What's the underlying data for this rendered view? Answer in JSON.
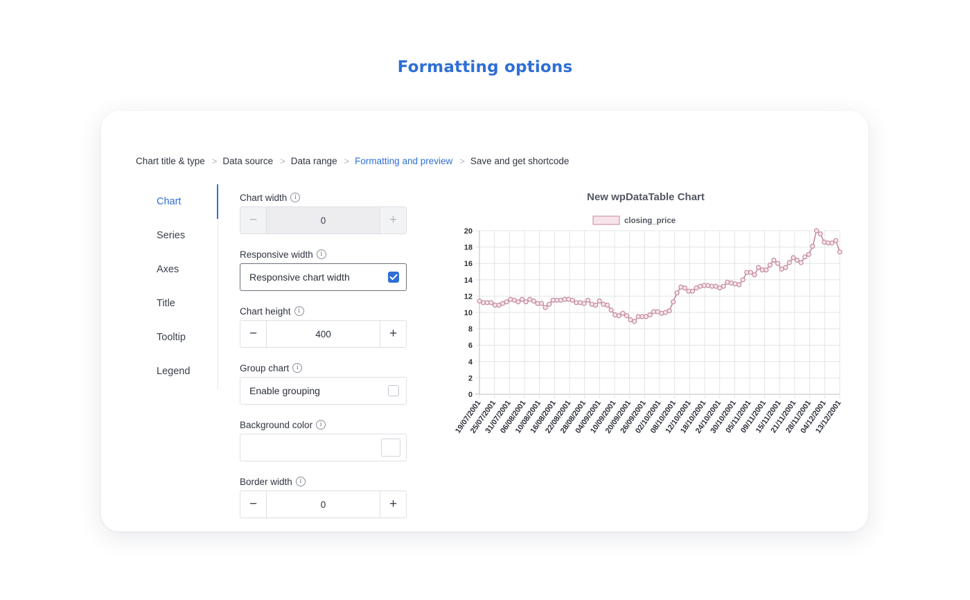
{
  "heading": "Formatting options",
  "breadcrumb": {
    "step1": "Chart title & type",
    "step2": "Data source",
    "step3": "Data range",
    "step4": "Formatting and preview",
    "step5": "Save and get shortcode",
    "separator": ">"
  },
  "sidebar": {
    "items": [
      "Chart",
      "Series",
      "Axes",
      "Title",
      "Tooltip",
      "Legend"
    ],
    "active": "Chart"
  },
  "form": {
    "chart_width": {
      "label": "Chart width",
      "value": "0",
      "disabled": true
    },
    "responsive_width": {
      "label": "Responsive width",
      "checkbox_label": "Responsive chart width",
      "checked": true
    },
    "chart_height": {
      "label": "Chart height",
      "value": "400"
    },
    "group_chart": {
      "label": "Group chart",
      "checkbox_label": "Enable grouping",
      "checked": false
    },
    "background_color": {
      "label": "Background color",
      "value": "#ffffff"
    },
    "border_width": {
      "label": "Border width",
      "value": "0"
    },
    "minus": "−",
    "plus": "+",
    "info": "i"
  },
  "colors": {
    "accent": "#2f6fd6",
    "series_line": "#c28a9b",
    "series_fill": "#f7e4ea"
  },
  "chart_data": {
    "type": "line",
    "title": "New wpDataTable Chart",
    "series": [
      {
        "name": "closing_price",
        "values": [
          11.4,
          11.2,
          11.2,
          11.2,
          10.9,
          10.9,
          11.1,
          11.3,
          11.6,
          11.5,
          11.3,
          11.6,
          11.3,
          11.6,
          11.4,
          11.1,
          11.1,
          10.6,
          11.0,
          11.5,
          11.5,
          11.5,
          11.6,
          11.6,
          11.5,
          11.2,
          11.2,
          11.1,
          11.5,
          11.0,
          10.9,
          11.4,
          11.0,
          10.9,
          10.3,
          9.7,
          9.6,
          9.9,
          9.6,
          9.1,
          8.9,
          9.5,
          9.5,
          9.5,
          9.7,
          10.1,
          10.1,
          9.9,
          10.0,
          10.2,
          11.3,
          12.4,
          13.1,
          13.0,
          12.6,
          12.6,
          13.0,
          13.2,
          13.3,
          13.3,
          13.2,
          13.2,
          13.0,
          13.2,
          13.7,
          13.6,
          13.5,
          13.4,
          14.0,
          14.9,
          14.9,
          14.6,
          15.5,
          15.2,
          15.2,
          15.8,
          16.4,
          16.0,
          15.3,
          15.5,
          16.1,
          16.7,
          16.4,
          16.1,
          16.8,
          17.1,
          18.1,
          20.0,
          19.6,
          18.6,
          18.5,
          18.5,
          18.8,
          17.4
        ]
      }
    ],
    "x_labels": [
      "19/07/2001",
      "25/07/2001",
      "31/07/2001",
      "06/08/2001",
      "10/08/2001",
      "16/08/2001",
      "22/08/2001",
      "28/08/2001",
      "04/09/2001",
      "10/09/2001",
      "20/09/2001",
      "26/09/2001",
      "02/10/2001",
      "08/10/2001",
      "12/10/2001",
      "18/10/2001",
      "24/10/2001",
      "30/10/2001",
      "05/11/2001",
      "09/11/2001",
      "15/11/2001",
      "21/11/2001",
      "28/11/2001",
      "04/12/2001",
      "13/12/2001"
    ],
    "y_ticks": [
      "0",
      "2",
      "4",
      "6",
      "8",
      "10",
      "12",
      "14",
      "16",
      "18",
      "20"
    ],
    "ylim": [
      0,
      20
    ],
    "grid": true,
    "legend": "top"
  }
}
